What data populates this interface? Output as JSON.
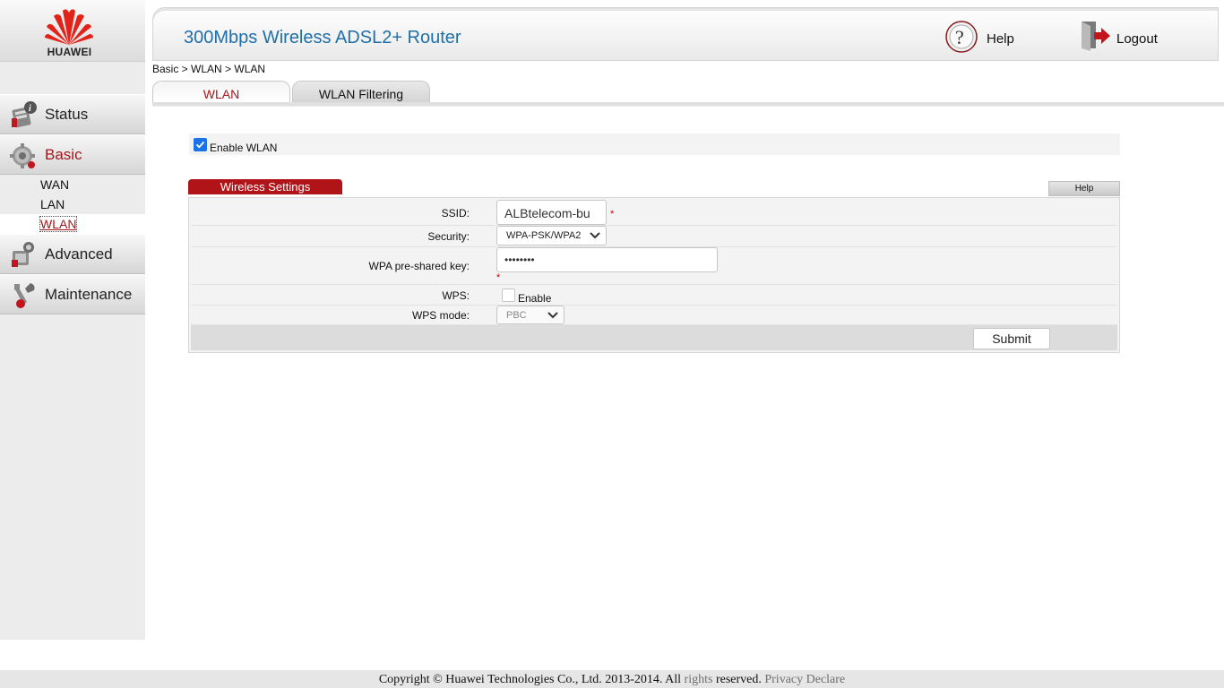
{
  "brand": {
    "name": "HUAWEI"
  },
  "header": {
    "title": "300Mbps Wireless ADSL2+ Router",
    "help_label": "Help",
    "logout_label": "Logout"
  },
  "sidebar": {
    "items": [
      {
        "label": "Status",
        "icon": "status-icon"
      },
      {
        "label": "Basic",
        "icon": "gear-icon",
        "active": true,
        "subitems": [
          {
            "label": "WAN"
          },
          {
            "label": "LAN"
          },
          {
            "label": "WLAN",
            "current": true
          }
        ]
      },
      {
        "label": "Advanced",
        "icon": "advanced-icon"
      },
      {
        "label": "Maintenance",
        "icon": "maintenance-icon"
      }
    ]
  },
  "breadcrumb": "Basic > WLAN > WLAN",
  "tabs": [
    {
      "label": "WLAN",
      "active": true
    },
    {
      "label": "WLAN Filtering",
      "active": false
    }
  ],
  "enable_wlan": {
    "label": "Enable WLAN",
    "checked": true
  },
  "wireless_settings": {
    "title": "Wireless Settings",
    "help_label": "Help",
    "ssid": {
      "label": "SSID:",
      "value": "ALBtelecom-bu",
      "required": "*"
    },
    "security": {
      "label": "Security:",
      "value": "WPA-PSK/WPA2"
    },
    "wpa_key": {
      "label": "WPA pre-shared key:",
      "value": "••••••••",
      "required": "*"
    },
    "wps": {
      "label": "WPS:",
      "checkbox_label": "Enable",
      "checked": false
    },
    "wps_mode": {
      "label": "WPS mode:",
      "value": "PBC"
    },
    "submit_label": "Submit"
  },
  "footer": {
    "text_1": "Copyright © Huawei Technologies Co., Ltd. 2013-2014. All",
    "text_2": "rights",
    "text_3": "reserved.",
    "privacy": "Privacy Declare"
  },
  "colors": {
    "accent_red": "#b01418",
    "title_blue": "#1f6fa8",
    "checkbox_blue": "#1a73e8"
  }
}
